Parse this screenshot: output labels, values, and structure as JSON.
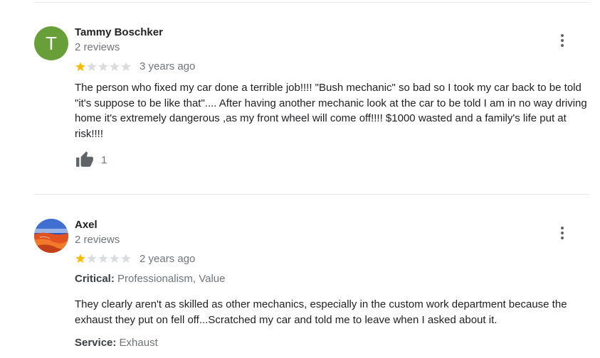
{
  "reviews": [
    {
      "avatar_letter": "T",
      "avatar_color": "#689f38",
      "name": "Tammy Boschker",
      "subtitle": "2 reviews",
      "rating": 1,
      "date": "3 years ago",
      "text": "The person who fixed my car done a terrible job!!!! \"Bush mechanic\" so bad so I took my car back to be told \"it's suppose to be like that\".... After having another mechanic look at the car to be told I am in no way driving home it's extremely dangerous ,as my front wheel will come off!!!! $1000 wasted and a family's life put at risk!!!!",
      "likes": "1"
    },
    {
      "name": "Axel",
      "subtitle": "2 reviews",
      "rating": 1,
      "date": "2 years ago",
      "critical_label": "Critical:",
      "critical_value": "Professionalism, Value",
      "text": "They clearly aren't as skilled as other mechanics, especially in the custom work department because the exhaust they put on fell off...Scratched my car and told me to leave when I asked about it.",
      "service_label": "Service:",
      "service_value": "Exhaust"
    }
  ],
  "colors": {
    "star_filled": "#fbbc04",
    "star_empty": "#dadce0"
  }
}
